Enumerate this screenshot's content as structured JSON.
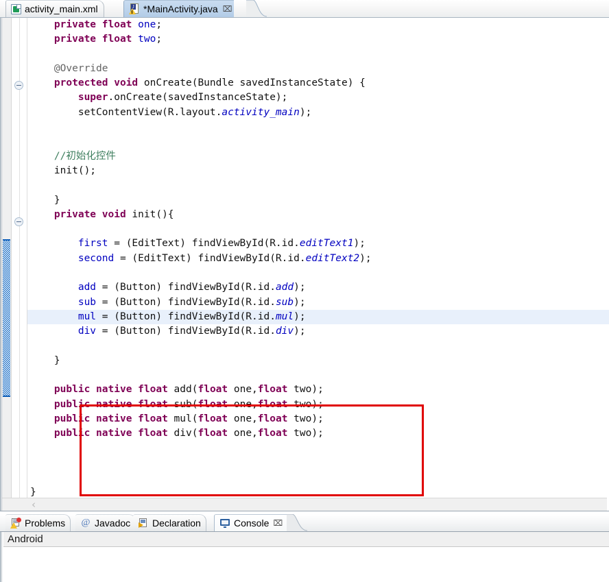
{
  "editor": {
    "tabs": [
      {
        "label": "activity_main.xml",
        "icon": "xml-file-icon",
        "active": false,
        "closable": false
      },
      {
        "label": "*MainActivity.java",
        "icon": "java-file-warning-icon",
        "active": true,
        "closable": true,
        "close_glyph": "⌧"
      }
    ],
    "code_lines": [
      {
        "indent": 1,
        "tokens": [
          {
            "t": "private",
            "c": "kw"
          },
          {
            "t": " ",
            "c": ""
          },
          {
            "t": "float",
            "c": "kw"
          },
          {
            "t": " ",
            "c": ""
          },
          {
            "t": "one",
            "c": "fld"
          },
          {
            "t": ";",
            "c": ""
          }
        ]
      },
      {
        "indent": 1,
        "tokens": [
          {
            "t": "private",
            "c": "kw"
          },
          {
            "t": " ",
            "c": ""
          },
          {
            "t": "float",
            "c": "kw"
          },
          {
            "t": " ",
            "c": ""
          },
          {
            "t": "two",
            "c": "fld"
          },
          {
            "t": ";",
            "c": ""
          }
        ]
      },
      {
        "indent": 0,
        "tokens": []
      },
      {
        "indent": 1,
        "tokens": [
          {
            "t": "@Override",
            "c": "ann"
          }
        ]
      },
      {
        "indent": 1,
        "tokens": [
          {
            "t": "protected",
            "c": "kw"
          },
          {
            "t": " ",
            "c": ""
          },
          {
            "t": "void",
            "c": "kw"
          },
          {
            "t": " onCreate(Bundle savedInstanceState) {",
            "c": ""
          }
        ]
      },
      {
        "indent": 2,
        "tokens": [
          {
            "t": "super",
            "c": "kw"
          },
          {
            "t": ".onCreate(savedInstanceState);",
            "c": ""
          }
        ]
      },
      {
        "indent": 2,
        "tokens": [
          {
            "t": "setContentView(R.layout.",
            "c": ""
          },
          {
            "t": "activity_main",
            "c": "stat"
          },
          {
            "t": ");",
            "c": ""
          }
        ]
      },
      {
        "indent": 0,
        "tokens": []
      },
      {
        "indent": 0,
        "tokens": []
      },
      {
        "indent": 1,
        "tokens": [
          {
            "t": "//初始化控件",
            "c": "cmt"
          }
        ]
      },
      {
        "indent": 1,
        "tokens": [
          {
            "t": "init();",
            "c": ""
          }
        ]
      },
      {
        "indent": 0,
        "tokens": []
      },
      {
        "indent": 1,
        "tokens": [
          {
            "t": "}",
            "c": ""
          }
        ]
      },
      {
        "indent": 1,
        "tokens": [
          {
            "t": "private",
            "c": "kw"
          },
          {
            "t": " ",
            "c": ""
          },
          {
            "t": "void",
            "c": "kw"
          },
          {
            "t": " init(){",
            "c": ""
          }
        ]
      },
      {
        "indent": 0,
        "tokens": []
      },
      {
        "indent": 2,
        "tokens": [
          {
            "t": "first",
            "c": "fld"
          },
          {
            "t": " = (EditText) findViewById(R.id.",
            "c": ""
          },
          {
            "t": "editText1",
            "c": "stat"
          },
          {
            "t": ");",
            "c": ""
          }
        ]
      },
      {
        "indent": 2,
        "tokens": [
          {
            "t": "second",
            "c": "fld"
          },
          {
            "t": " = (EditText) findViewById(R.id.",
            "c": ""
          },
          {
            "t": "editText2",
            "c": "stat"
          },
          {
            "t": ");",
            "c": ""
          }
        ]
      },
      {
        "indent": 0,
        "tokens": []
      },
      {
        "indent": 2,
        "tokens": [
          {
            "t": "add",
            "c": "fld"
          },
          {
            "t": " = (Button) findViewById(R.id.",
            "c": ""
          },
          {
            "t": "add",
            "c": "stat"
          },
          {
            "t": ");",
            "c": ""
          }
        ]
      },
      {
        "indent": 2,
        "tokens": [
          {
            "t": "sub",
            "c": "fld"
          },
          {
            "t": " = (Button) findViewById(R.id.",
            "c": ""
          },
          {
            "t": "sub",
            "c": "stat"
          },
          {
            "t": ");",
            "c": ""
          }
        ]
      },
      {
        "indent": 2,
        "tokens": [
          {
            "t": "mul",
            "c": "fld"
          },
          {
            "t": " = (Button) findViewById(R.id.",
            "c": ""
          },
          {
            "t": "mul",
            "c": "stat"
          },
          {
            "t": ");",
            "c": ""
          }
        ]
      },
      {
        "indent": 2,
        "tokens": [
          {
            "t": "div",
            "c": "fld"
          },
          {
            "t": " = (Button) findViewById(R.id.",
            "c": ""
          },
          {
            "t": "div",
            "c": "stat"
          },
          {
            "t": ");",
            "c": ""
          }
        ]
      },
      {
        "indent": 0,
        "tokens": []
      },
      {
        "indent": 1,
        "tokens": [
          {
            "t": "}",
            "c": ""
          }
        ]
      },
      {
        "indent": 0,
        "tokens": []
      },
      {
        "indent": 1,
        "tokens": [
          {
            "t": "public",
            "c": "kw"
          },
          {
            "t": " ",
            "c": ""
          },
          {
            "t": "native",
            "c": "kw"
          },
          {
            "t": " ",
            "c": ""
          },
          {
            "t": "float",
            "c": "kw"
          },
          {
            "t": " add(",
            "c": ""
          },
          {
            "t": "float",
            "c": "kw"
          },
          {
            "t": " one,",
            "c": ""
          },
          {
            "t": "float",
            "c": "kw"
          },
          {
            "t": " two);",
            "c": ""
          }
        ]
      },
      {
        "indent": 1,
        "tokens": [
          {
            "t": "public",
            "c": "kw"
          },
          {
            "t": " ",
            "c": ""
          },
          {
            "t": "native",
            "c": "kw"
          },
          {
            "t": " ",
            "c": ""
          },
          {
            "t": "float",
            "c": "kw"
          },
          {
            "t": " sub(",
            "c": ""
          },
          {
            "t": "float",
            "c": "kw"
          },
          {
            "t": " one,",
            "c": ""
          },
          {
            "t": "float",
            "c": "kw"
          },
          {
            "t": " two);",
            "c": ""
          }
        ]
      },
      {
        "indent": 1,
        "tokens": [
          {
            "t": "public",
            "c": "kw"
          },
          {
            "t": " ",
            "c": ""
          },
          {
            "t": "native",
            "c": "kw"
          },
          {
            "t": " ",
            "c": ""
          },
          {
            "t": "float",
            "c": "kw"
          },
          {
            "t": " mul(",
            "c": ""
          },
          {
            "t": "float",
            "c": "kw"
          },
          {
            "t": " one,",
            "c": ""
          },
          {
            "t": "float",
            "c": "kw"
          },
          {
            "t": " two);",
            "c": ""
          }
        ]
      },
      {
        "indent": 1,
        "tokens": [
          {
            "t": "public",
            "c": "kw"
          },
          {
            "t": " ",
            "c": ""
          },
          {
            "t": "native",
            "c": "kw"
          },
          {
            "t": " ",
            "c": ""
          },
          {
            "t": "float",
            "c": "kw"
          },
          {
            "t": " div(",
            "c": ""
          },
          {
            "t": "float",
            "c": "kw"
          },
          {
            "t": " one,",
            "c": ""
          },
          {
            "t": "float",
            "c": "kw"
          },
          {
            "t": " two);",
            "c": ""
          }
        ]
      },
      {
        "indent": 0,
        "tokens": []
      },
      {
        "indent": 0,
        "tokens": []
      },
      {
        "indent": 0,
        "tokens": []
      },
      {
        "indent": 0,
        "tokens": [
          {
            "t": "}",
            "c": ""
          }
        ]
      }
    ],
    "highlighted_line_index": 19,
    "annotation_box": {
      "color": "#e00000",
      "label": "native-methods-highlight-box"
    },
    "scrollbar": {
      "left_arrow_glyph": "‹"
    },
    "gutter": {
      "fold_markers": [
        "collapse-marker-oncreate",
        "collapse-marker-init"
      ],
      "overview_marker": "green-triangle-marker",
      "change_marker": "modified-lines-bar"
    },
    "colors": {
      "keyword": "#7f0055",
      "field": "#0000c0",
      "comment": "#3f7f5f",
      "static_italic": "#0000c0",
      "annotation": "#646464",
      "current_line_bg": "#e8f0fb",
      "box_red": "#e00000",
      "change_blue": "#1269c4"
    }
  },
  "bottom_panel": {
    "tabs": [
      {
        "label": "Problems",
        "icon": "problems-icon",
        "active": false,
        "closable": false
      },
      {
        "label": "Javadoc",
        "icon": "javadoc-icon",
        "glyph": "@",
        "active": false,
        "closable": false
      },
      {
        "label": "Declaration",
        "icon": "declaration-icon",
        "active": false,
        "closable": false
      },
      {
        "label": "Console",
        "icon": "console-icon",
        "active": true,
        "closable": true,
        "close_glyph": "⌧"
      }
    ],
    "console_title": "Android",
    "console_output": ""
  }
}
